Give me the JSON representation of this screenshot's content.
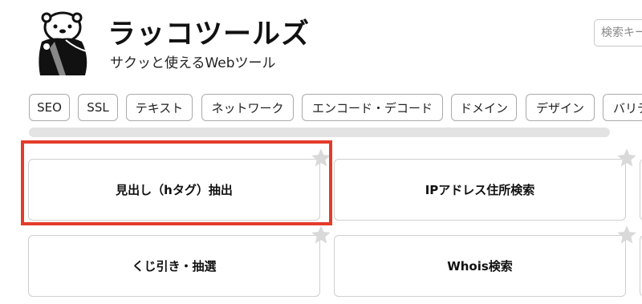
{
  "site": {
    "title": "ラッコツールズ",
    "tagline": "サクッと使えるWebツール"
  },
  "search": {
    "placeholder": "検索キーワード"
  },
  "categories": [
    "SEO",
    "SSL",
    "テキスト",
    "ネットワーク",
    "エンコード・デコード",
    "ドメイン",
    "デザイン",
    "バリデ"
  ],
  "tools": [
    {
      "label": "見出し（hタグ）抽出"
    },
    {
      "label": "IPアドレス住所検索"
    },
    {
      "label": "くじ引き・抽選"
    },
    {
      "label": "Whois検索"
    }
  ],
  "colors": {
    "highlight": "#e43c2a",
    "star": "#d9d9d9",
    "border": "#cfcfcf"
  }
}
